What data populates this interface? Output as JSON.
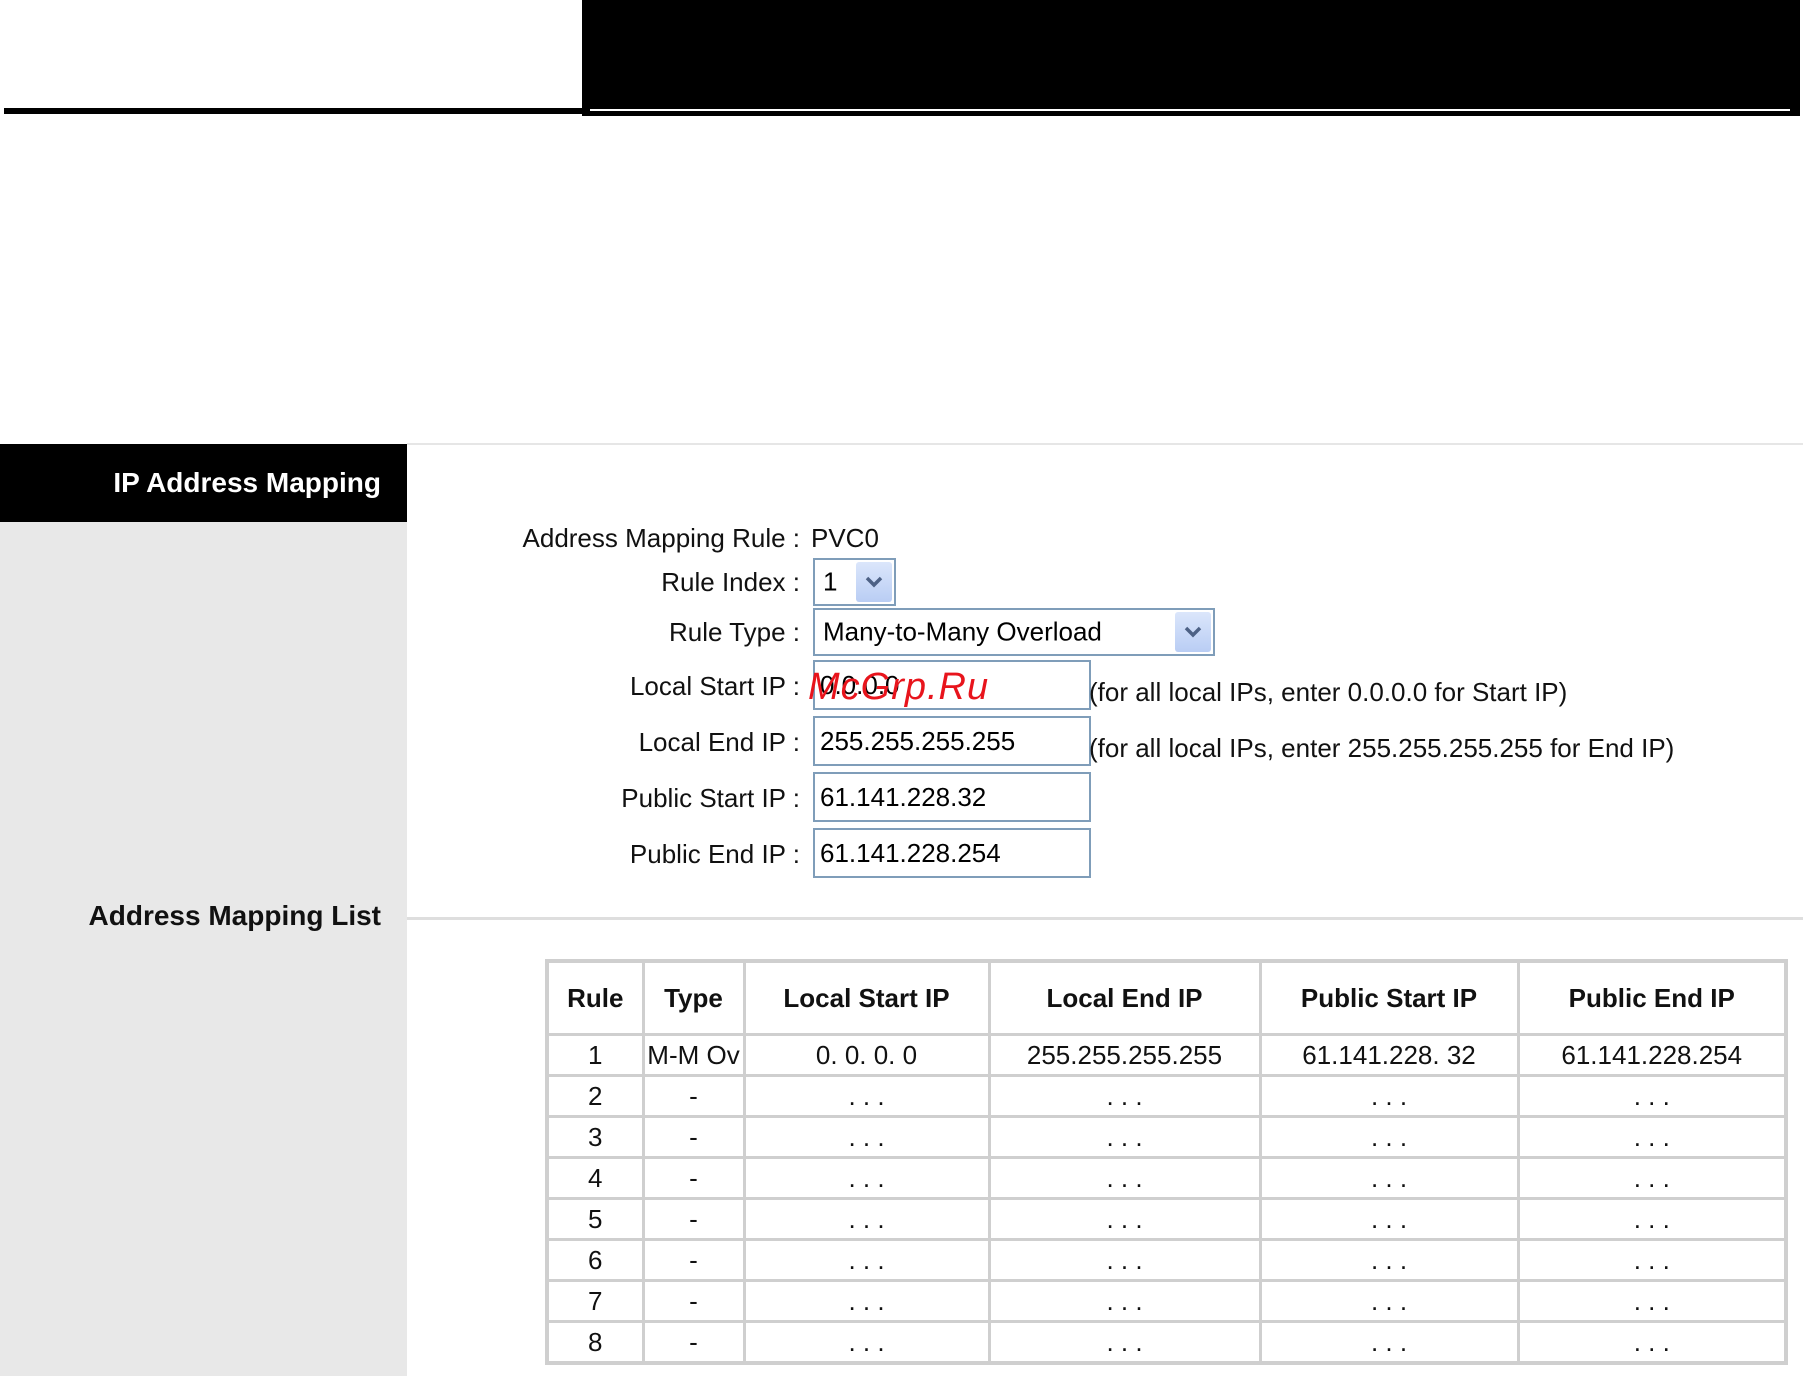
{
  "sidebar": {
    "title": "IP Address Mapping",
    "section": "Address Mapping List"
  },
  "form": {
    "rule_label": "Address Mapping Rule :",
    "rule_value": "PVC0",
    "rule_index_label": "Rule Index :",
    "rule_index_value": "1",
    "rule_type_label": "Rule Type :",
    "rule_type_value": "Many-to-Many Overload",
    "local_start_label": "Local Start IP :",
    "local_start_value": "0.0.0.0",
    "local_start_hint": "(for all local IPs, enter 0.0.0.0 for Start IP)",
    "local_end_label": "Local End IP :",
    "local_end_value": "255.255.255.255",
    "local_end_hint": "(for all local IPs, enter 255.255.255.255 for End IP)",
    "public_start_label": "Public Start IP :",
    "public_start_value": "61.141.228.32",
    "public_end_label": "Public End IP :",
    "public_end_value": "61.141.228.254"
  },
  "watermark": "McGrp.Ru",
  "table": {
    "headers": [
      "Rule",
      "Type",
      "Local Start IP",
      "Local End IP",
      "Public Start IP",
      "Public End IP"
    ],
    "rows": [
      [
        "1",
        "M-M Ov",
        "0. 0. 0. 0",
        "255.255.255.255",
        "61.141.228. 32",
        "61.141.228.254"
      ],
      [
        "2",
        "-",
        ". . .",
        ". . .",
        ". . .",
        ". . ."
      ],
      [
        "3",
        "-",
        ". . .",
        ". . .",
        ". . .",
        ". . ."
      ],
      [
        "4",
        "-",
        ". . .",
        ". . .",
        ". . .",
        ". . ."
      ],
      [
        "5",
        "-",
        ". . .",
        ". . .",
        ". . .",
        ". . ."
      ],
      [
        "6",
        "-",
        ". . .",
        ". . .",
        ". . .",
        ". . ."
      ],
      [
        "7",
        "-",
        ". . .",
        ". . .",
        ". . .",
        ". . ."
      ],
      [
        "8",
        "-",
        ". . .",
        ". . .",
        ". . .",
        ". . ."
      ]
    ]
  },
  "colors": {
    "border": "#cfcfcf",
    "input_border": "#7f9db9",
    "sidebar": "#e8e8e8"
  }
}
